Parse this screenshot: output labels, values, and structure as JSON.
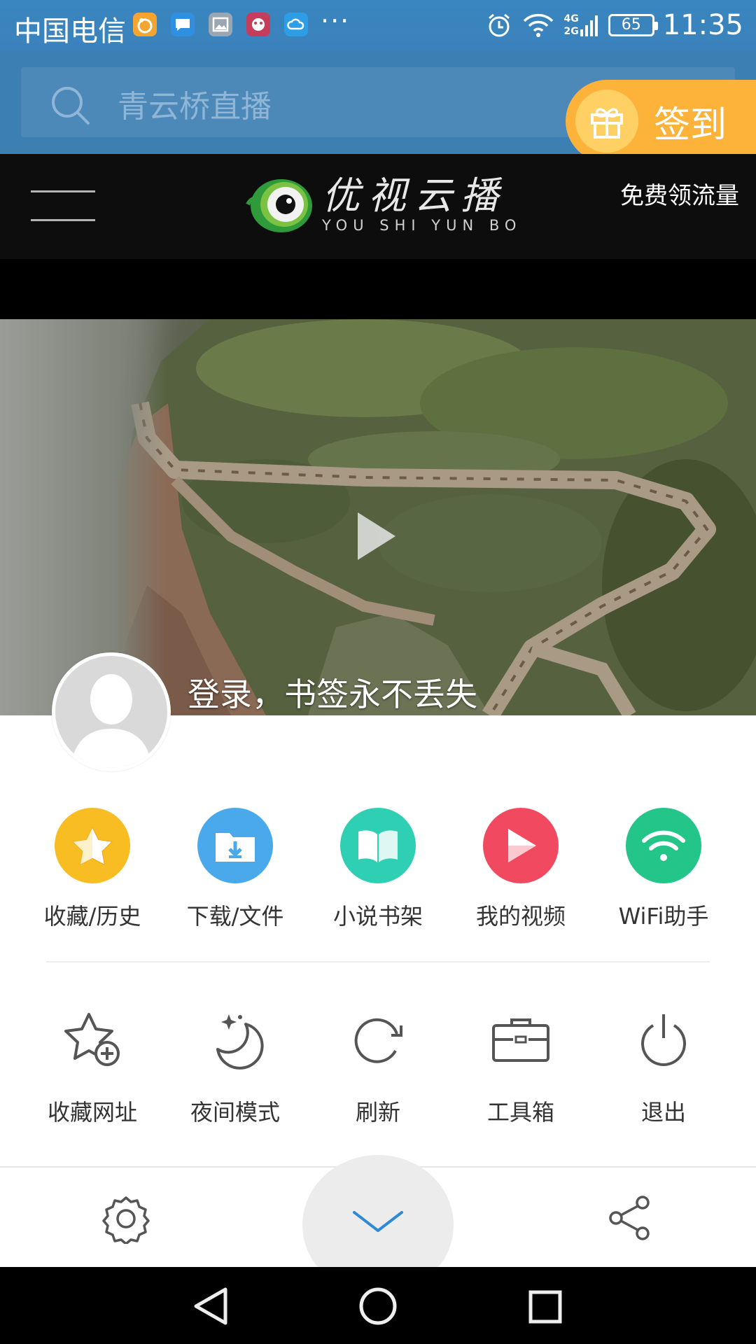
{
  "status_bar": {
    "carrier": "中国电信",
    "notification_icons": [
      "uc-browser-icon",
      "message-icon",
      "gallery-icon",
      "game-icon",
      "cloud-icon"
    ],
    "more": "···",
    "network": [
      "4G",
      "2G"
    ],
    "battery": "65",
    "time": "11:35"
  },
  "search": {
    "placeholder": "青云桥直播"
  },
  "signin": {
    "label": "签到"
  },
  "header": {
    "logo_cn": "优视云播",
    "logo_en": "YOU SHI YUN BO",
    "free_flow": "免费领流量"
  },
  "hero": {
    "login_prompt": "登录，书签永不丢失"
  },
  "quick_actions": [
    {
      "label": "收藏/历史",
      "icon": "star-icon",
      "color": "#f9bd24"
    },
    {
      "label": "下载/文件",
      "icon": "download-folder-icon",
      "color": "#4aa9ea"
    },
    {
      "label": "小说书架",
      "icon": "book-icon",
      "color": "#2fcfb4"
    },
    {
      "label": "我的视频",
      "icon": "play-icon",
      "color": "#f14a60"
    },
    {
      "label": "WiFi助手",
      "icon": "wifi-icon",
      "color": "#23c688"
    }
  ],
  "tools": [
    {
      "label": "收藏网址",
      "icon": "bookmark-add-icon"
    },
    {
      "label": "夜间模式",
      "icon": "moon-icon"
    },
    {
      "label": "刷新",
      "icon": "refresh-icon"
    },
    {
      "label": "工具箱",
      "icon": "toolbox-icon"
    },
    {
      "label": "退出",
      "icon": "power-icon"
    }
  ],
  "bottom_bar": {
    "left_icon": "settings-icon",
    "center_icon": "chevron-down-icon",
    "right_icon": "share-icon"
  },
  "colors": {
    "status_bar": "#3a86c0",
    "search_bg": "#3c7fb3",
    "signin_bg": "#fdb33a",
    "accent": "#2f8ad6"
  }
}
